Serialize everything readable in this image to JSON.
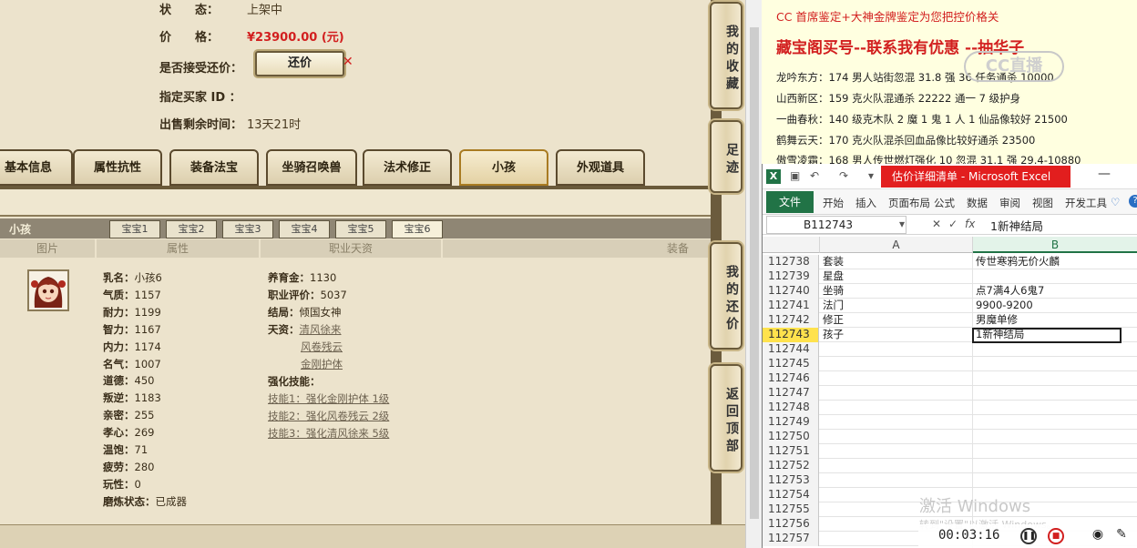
{
  "game": {
    "status_label": "状　　态：",
    "status_value": "上架中",
    "price_label": "价　　格：",
    "price_value": "¥23900.00 (元)",
    "bargain_label": "是否接受还价：",
    "bargain_button": "还价",
    "buyer_label": "指定买家 ID ：",
    "remaining_label": "出售剩余时间：",
    "remaining_value": "13天21时",
    "main_tabs": [
      "基本信息",
      "属性抗性",
      "装备法宝",
      "坐骑召唤兽",
      "法术修正",
      "小孩",
      "外观道具"
    ],
    "active_main_tab": "小孩",
    "sub_title": "小孩",
    "sub_tabs": [
      "宝宝1",
      "宝宝2",
      "宝宝3",
      "宝宝4",
      "宝宝5",
      "宝宝6"
    ],
    "active_sub_tab": "宝宝6",
    "columns": [
      "图片",
      "属性",
      "职业天资",
      "装备"
    ],
    "stats_left": [
      {
        "k": "乳名：",
        "v": "小孩6"
      },
      {
        "k": "气质：",
        "v": "1157"
      },
      {
        "k": "耐力：",
        "v": "1199"
      },
      {
        "k": "智力：",
        "v": "1167"
      },
      {
        "k": "内力：",
        "v": "1174"
      },
      {
        "k": "名气：",
        "v": "1007"
      },
      {
        "k": "道德：",
        "v": "450"
      },
      {
        "k": "叛逆：",
        "v": "1183"
      },
      {
        "k": "亲密：",
        "v": "255"
      },
      {
        "k": "孝心：",
        "v": "269"
      },
      {
        "k": "温饱：",
        "v": "71"
      },
      {
        "k": "疲劳：",
        "v": "280"
      },
      {
        "k": "玩性：",
        "v": "0"
      },
      {
        "k": "磨炼状态：",
        "v": "已成器"
      }
    ],
    "stats_mid": {
      "raise_label": "养育金：",
      "raise_value": "1130",
      "score_label": "职业评价：",
      "score_value": "5037",
      "ending_label": "结局：",
      "ending_value": "倾国女神",
      "talent_label": "天资：",
      "talents": [
        "清风徐来",
        "风卷残云",
        "金刚护体"
      ],
      "skills_label": "强化技能：",
      "skills": [
        "技能1：强化金刚护体 1级",
        "技能2：强化风卷残云 2级",
        "技能3：强化清风徐来 5级"
      ]
    },
    "side_buttons": [
      "我的收藏",
      "足迹",
      "我的还价",
      "返回顶部"
    ]
  },
  "doc": {
    "line1": "CC 首席鉴定+大神金牌鉴定为您把控价格关",
    "line2": "藏宝阁买号--联系我有优惠 --抽华子",
    "line3": "龙吟东方：174 男人站街忽混 31.8 强 36 任务通杀 10000",
    "line4": "山西新区：159 克火队混通杀 22222 通一 7 级护身",
    "line5": "一曲春秋：140 级克木队 2 魔 1 鬼 1 人 1 仙品像较好 21500",
    "line6": "鹤舞云天：170 克火队混杀回血品像比较好通杀 23500",
    "line7": "傲雪凌霜：168 男人传世燃灯强化 10 忽混 31.1 强 29.4-10880",
    "watermark": "CC直播"
  },
  "excel": {
    "title": "估价详细清单 - Microsoft Excel",
    "file_tab": "文件",
    "ribbon_tabs": [
      "开始",
      "插入",
      "页面布局",
      "公式",
      "数据",
      "审阅",
      "视图",
      "开发工具"
    ],
    "namebox": "B112743",
    "formula": "1新神结局",
    "col_a": "A",
    "col_b": "B",
    "rows": [
      {
        "n": "112738",
        "a": "套装",
        "b": "传世寒鸦无价火麟"
      },
      {
        "n": "112739",
        "a": "星盘",
        "b": ""
      },
      {
        "n": "112740",
        "a": "坐骑",
        "b": "点7满4人6鬼7"
      },
      {
        "n": "112741",
        "a": "法门",
        "b": "9900-9200"
      },
      {
        "n": "112742",
        "a": "修正",
        "b": "男魔单修"
      },
      {
        "n": "112743",
        "a": "孩子",
        "b": "1新神结局"
      },
      {
        "n": "112744",
        "a": "",
        "b": ""
      },
      {
        "n": "112745",
        "a": "",
        "b": ""
      },
      {
        "n": "112746",
        "a": "",
        "b": ""
      },
      {
        "n": "112747",
        "a": "",
        "b": ""
      },
      {
        "n": "112748",
        "a": "",
        "b": ""
      },
      {
        "n": "112749",
        "a": "",
        "b": ""
      },
      {
        "n": "112750",
        "a": "",
        "b": ""
      },
      {
        "n": "112751",
        "a": "",
        "b": ""
      },
      {
        "n": "112752",
        "a": "",
        "b": ""
      },
      {
        "n": "112753",
        "a": "",
        "b": ""
      },
      {
        "n": "112754",
        "a": "",
        "b": ""
      },
      {
        "n": "112755",
        "a": "",
        "b": ""
      },
      {
        "n": "112756",
        "a": "",
        "b": ""
      },
      {
        "n": "112757",
        "a": "",
        "b": ""
      }
    ],
    "active_row": "112743",
    "activate_title": "激活 Windows",
    "activate_sub": "转到\"设置\"以激活 Windows。"
  },
  "recorder": {
    "time": "00:03:16"
  },
  "colors": {
    "price": "#d21f1f",
    "excel_green": "#217346",
    "title_red": "#e21e1e"
  }
}
